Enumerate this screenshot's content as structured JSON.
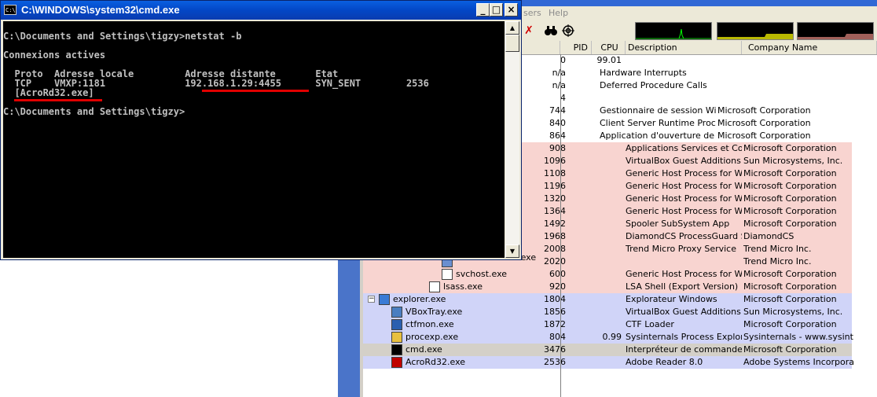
{
  "cmd": {
    "title": "C:\\WINDOWS\\system32\\cmd.exe",
    "icon": "C:\\",
    "buttons": {
      "minimize": "_",
      "maximize": "□",
      "close": "×"
    },
    "lines": [
      "C:\\Documents and Settings\\tigzy>netstat -b",
      "",
      "Connexions actives",
      "",
      "  Proto  Adresse locale         Adresse distante       Etat",
      "  TCP    VMXP:1181              192.168.1.29:4455      SYN_SENT        2536",
      "  [AcroRd32.exe]",
      "",
      "C:\\Documents and Settings\\tigzy>"
    ],
    "highlight_color": "#e00000"
  },
  "procexp": {
    "menu": {
      "users": "sers",
      "help": "Help"
    },
    "toolbar": {
      "kill": "✗",
      "find": "🔭",
      "target": "⊕"
    },
    "columns": {
      "pid": "PID",
      "cpu": "CPU",
      "description": "Description",
      "company": "Company Name"
    },
    "colors": {
      "services": "#f8d4d0",
      "own": "#d0d4f8",
      "selected": "#d4d0c8"
    },
    "rows": [
      {
        "pid": "0",
        "cpu": "99.01",
        "description": "",
        "company": "",
        "style": "plain"
      },
      {
        "pid": "n/a",
        "cpu": "",
        "description": "Hardware Interrupts",
        "company": "",
        "style": "plain"
      },
      {
        "pid": "n/a",
        "cpu": "",
        "description": "Deferred Procedure Calls",
        "company": "",
        "style": "plain"
      },
      {
        "pid": "4",
        "cpu": "",
        "description": "",
        "company": "",
        "style": "plain"
      },
      {
        "pid": "744",
        "cpu": "",
        "description": "Gestionnaire de session Win...",
        "company": "Microsoft Corporation",
        "style": "plain"
      },
      {
        "pid": "840",
        "cpu": "",
        "description": "Client Server Runtime Process",
        "company": "Microsoft Corporation",
        "style": "plain"
      },
      {
        "pid": "864",
        "cpu": "",
        "description": "Application d'ouverture de se...",
        "company": "Microsoft Corporation",
        "style": "plain"
      },
      {
        "pid": "908",
        "cpu": "",
        "description": "Applications Services et Con...",
        "company": "Microsoft Corporation",
        "style": "pink"
      },
      {
        "pid": "1096",
        "cpu": "",
        "description": "VirtualBox Guest Additions S...",
        "company": "Sun Microsystems, Inc.",
        "style": "pink"
      },
      {
        "pid": "1108",
        "cpu": "",
        "description": "Generic Host Process for Wi...",
        "company": "Microsoft Corporation",
        "style": "pink"
      },
      {
        "pid": "1196",
        "cpu": "",
        "description": "Generic Host Process for Wi...",
        "company": "Microsoft Corporation",
        "style": "pink"
      },
      {
        "pid": "1320",
        "cpu": "",
        "description": "Generic Host Process for Wi...",
        "company": "Microsoft Corporation",
        "style": "pink"
      },
      {
        "pid": "1364",
        "cpu": "",
        "description": "Generic Host Process for Wi...",
        "company": "Microsoft Corporation",
        "style": "pink"
      },
      {
        "pid": "1492",
        "cpu": "",
        "description": "Spooler SubSystem App",
        "company": "Microsoft Corporation",
        "style": "pink"
      },
      {
        "pid": "1968",
        "cpu": "",
        "description": "DiamondCS ProcessGuard S...",
        "company": "DiamondCS",
        "style": "pink"
      },
      {
        "pid": "2008",
        "cpu": "",
        "description": "Trend Micro Proxy Service",
        "company": "Trend Micro Inc.",
        "style": "pink"
      },
      {
        "pid": "2020",
        "cpu": "",
        "description": "",
        "company": "Trend Micro Inc.",
        "style": "pink",
        "process": "TMWebProtect.exe"
      },
      {
        "pid": "600",
        "cpu": "",
        "description": "Generic Host Process for Wi...",
        "company": "Microsoft Corporation",
        "style": "pink",
        "process": "svchost.exe"
      },
      {
        "pid": "920",
        "cpu": "",
        "description": "LSA Shell (Export Version)",
        "company": "Microsoft Corporation",
        "style": "pink",
        "process": "lsass.exe"
      },
      {
        "pid": "1804",
        "cpu": "",
        "description": "Explorateur Windows",
        "company": "Microsoft Corporation",
        "style": "blue",
        "process": "explorer.exe"
      },
      {
        "pid": "1856",
        "cpu": "",
        "description": "VirtualBox Guest Additions Tr...",
        "company": "Sun Microsystems, Inc.",
        "style": "blue",
        "process": "VBoxTray.exe"
      },
      {
        "pid": "1872",
        "cpu": "",
        "description": "CTF Loader",
        "company": "Microsoft Corporation",
        "style": "blue",
        "process": "ctfmon.exe"
      },
      {
        "pid": "804",
        "cpu": "0.99",
        "description": "Sysinternals Process Explorer",
        "company": "Sysinternals - www.sysinter...",
        "style": "blue",
        "process": "procexp.exe"
      },
      {
        "pid": "3476",
        "cpu": "",
        "description": "Interpréteur de commandes ...",
        "company": "Microsoft Corporation",
        "style": "sel",
        "process": "cmd.exe"
      },
      {
        "pid": "2536",
        "cpu": "",
        "description": "Adobe Reader 8.0",
        "company": "Adobe Systems Incorporated",
        "style": "blue",
        "process": "AcroRd32.exe"
      }
    ],
    "tree_expander": "−"
  }
}
